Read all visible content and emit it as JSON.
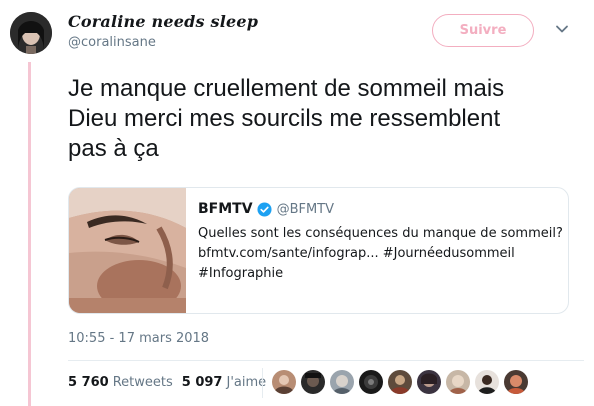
{
  "user": {
    "display_name": "Coraline needs sleep",
    "handle": "@coralinsane",
    "follow_label": "Suivre"
  },
  "tweet": {
    "text_lines": [
      "Je manque cruellement de sommeil mais",
      "Dieu merci mes sourcils me ressemblent",
      "pas à ça"
    ],
    "timestamp": "10:55 - 17 mars 2018"
  },
  "quoted": {
    "name": "BFMTV",
    "verified_icon": "verified-badge-icon",
    "handle": "@BFMTV",
    "text_lines": [
      "Quelles sont les conséquences du manque de sommeil?",
      "bfmtv.com/sante/infograp... #Journéedusommeil",
      "#Infographie"
    ]
  },
  "stats": {
    "retweets_count": "5 760",
    "retweets_label": "Retweets",
    "likes_count": "5 097",
    "likes_label": "J'aime"
  },
  "likers_count_shown": 9,
  "colors": {
    "follow_border": "#f3aec0",
    "thread_line": "#f5c6d3",
    "verified": "#1da1f2",
    "secondary_text": "#657786"
  }
}
